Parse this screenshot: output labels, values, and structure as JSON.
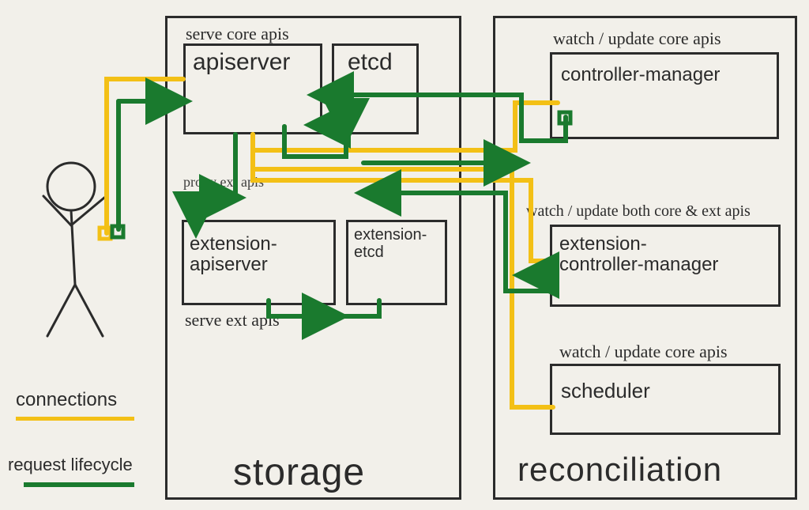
{
  "storage": {
    "title": "storage",
    "serve_core_label": "serve core apis",
    "serve_ext_label": "serve ext apis",
    "proxy_ext_label": "proxy ext apis",
    "apiserver": "apiserver",
    "etcd": "etcd",
    "extension_apiserver": "extension-\napiserver",
    "extension_etcd": "extension-\netcd"
  },
  "reconciliation": {
    "title": "reconciliation",
    "cm_watch_label": "watch / update core apis",
    "ecm_watch_label": "watch / update both core & ext apis",
    "sched_watch_label": "watch / update core apis",
    "controller_manager": "controller-manager",
    "extension_controller_manager": "extension-\ncontroller-manager",
    "scheduler": "scheduler"
  },
  "legend": {
    "connections": "connections",
    "request_lifecycle": "request lifecycle"
  },
  "colors": {
    "yellow": "#f3c016",
    "green": "#1a7a2e",
    "ink": "#2b2b2b"
  },
  "actor_icon": "stick-figure"
}
